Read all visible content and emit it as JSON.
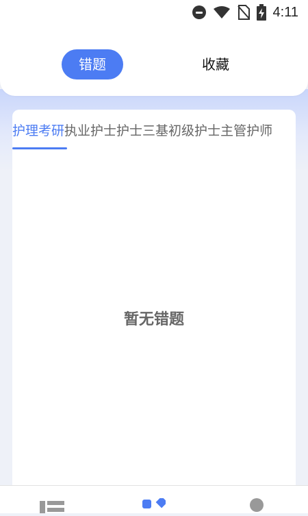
{
  "status_bar": {
    "time": "4:11",
    "icons": [
      "do-not-disturb-icon",
      "wifi-icon",
      "no-sim-icon",
      "battery-charging-icon"
    ]
  },
  "tabs": [
    {
      "label": "错题",
      "active": true
    },
    {
      "label": "收藏",
      "active": false
    }
  ],
  "categories": [
    {
      "label": "护理考研",
      "active": true
    },
    {
      "label": "执业护士",
      "active": false
    },
    {
      "label": "护士三基",
      "active": false
    },
    {
      "label": "初级护士",
      "active": false
    },
    {
      "label": "主管护师",
      "active": false
    }
  ],
  "empty_message": "暂无错题",
  "bottom_nav": {
    "items": [
      "list-icon",
      "grid-diamond-icon",
      "profile-icon"
    ]
  },
  "colors": {
    "accent": "#4c7cf3",
    "background": "#eef1f8"
  }
}
